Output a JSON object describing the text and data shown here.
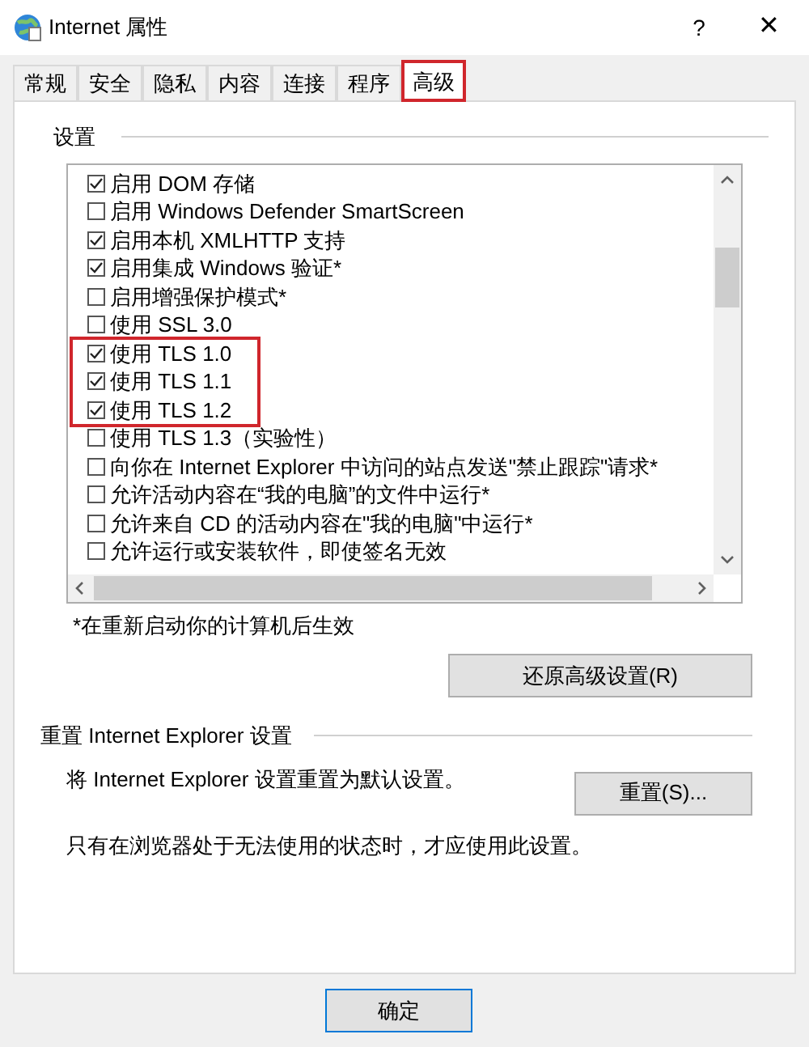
{
  "window": {
    "title": "Internet 属性",
    "help": "?",
    "close": "✕"
  },
  "tabs": [
    {
      "label": "常规",
      "selected": false,
      "highlighted": false
    },
    {
      "label": "安全",
      "selected": false,
      "highlighted": false
    },
    {
      "label": "隐私",
      "selected": false,
      "highlighted": false
    },
    {
      "label": "内容",
      "selected": false,
      "highlighted": false
    },
    {
      "label": "连接",
      "selected": false,
      "highlighted": false
    },
    {
      "label": "程序",
      "selected": false,
      "highlighted": false
    },
    {
      "label": "高级",
      "selected": true,
      "highlighted": true
    }
  ],
  "settings": {
    "title": "设置",
    "items": [
      {
        "label": "启用 DOM 存储",
        "checked": true,
        "highlighted": false
      },
      {
        "label": "启用 Windows Defender SmartScreen",
        "checked": false,
        "highlighted": false
      },
      {
        "label": "启用本机 XMLHTTP 支持",
        "checked": true,
        "highlighted": false
      },
      {
        "label": "启用集成 Windows 验证*",
        "checked": true,
        "highlighted": false
      },
      {
        "label": "启用增强保护模式*",
        "checked": false,
        "highlighted": false
      },
      {
        "label": "使用 SSL 3.0",
        "checked": false,
        "highlighted": false
      },
      {
        "label": "使用 TLS 1.0",
        "checked": true,
        "highlighted": true
      },
      {
        "label": "使用 TLS 1.1",
        "checked": true,
        "highlighted": true
      },
      {
        "label": "使用 TLS 1.2",
        "checked": true,
        "highlighted": true
      },
      {
        "label": "使用 TLS 1.3（实验性）",
        "checked": false,
        "highlighted": false
      },
      {
        "label": "向你在 Internet Explorer 中访问的站点发送\"禁止跟踪\"请求*",
        "checked": false,
        "highlighted": false
      },
      {
        "label": "允许活动内容在“我的电脑”的文件中运行*",
        "checked": false,
        "highlighted": false
      },
      {
        "label": "允许来自 CD 的活动内容在\"我的电脑\"中运行*",
        "checked": false,
        "highlighted": false
      },
      {
        "label": "允许运行或安装软件，即使签名无效",
        "checked": false,
        "highlighted": false
      }
    ],
    "note": "*在重新启动你的计算机后生效",
    "restore_button": "还原高级设置(R)"
  },
  "reset": {
    "title": "重置 Internet Explorer 设置",
    "description": "将 Internet Explorer 设置重置为默认设置。",
    "button": "重置(S)...",
    "warning": "只有在浏览器处于无法使用的状态时，才应使用此设置。"
  },
  "buttons": [
    "确定"
  ]
}
